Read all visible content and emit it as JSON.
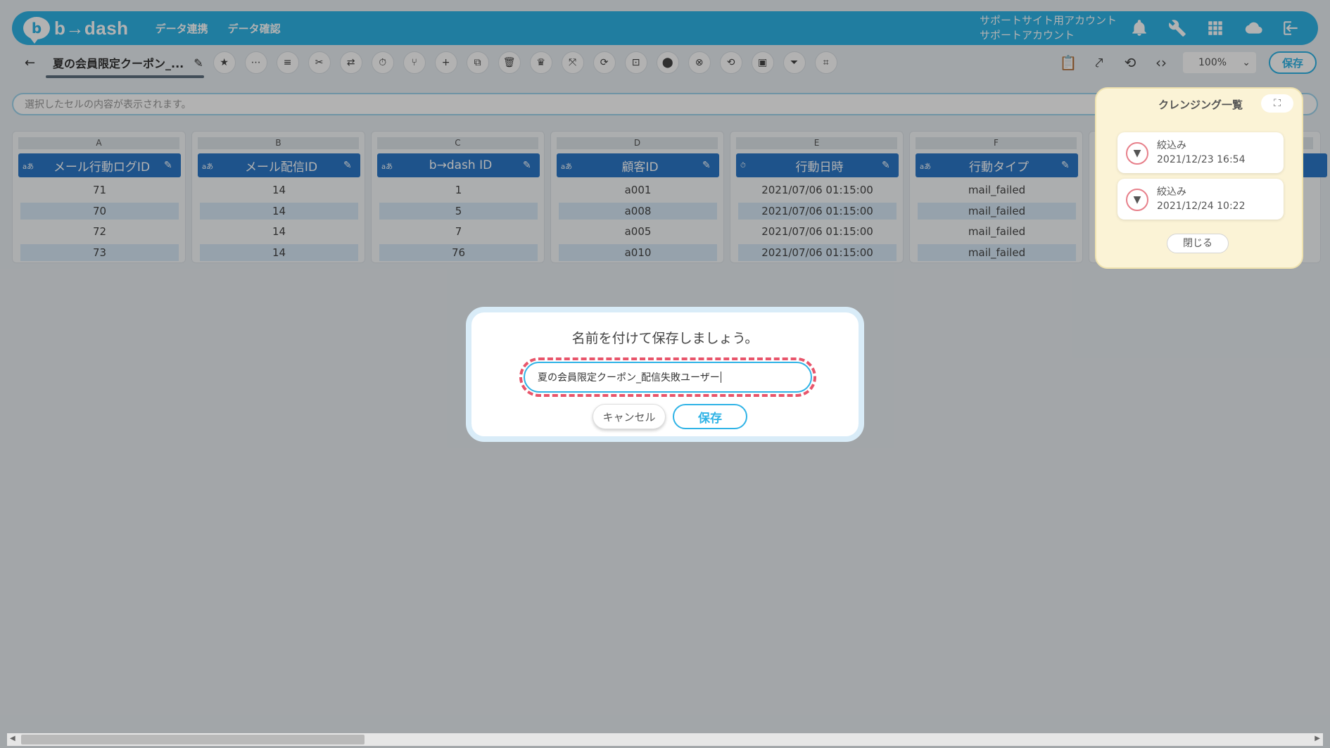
{
  "header": {
    "logo_mark": "b",
    "logo_text": "b→dash",
    "nav": [
      "データ連携",
      "データ確認"
    ],
    "account_line1": "サポートサイト用アカウント",
    "account_line2": "サポートアカウント",
    "icons": [
      "bell-icon",
      "wrench-icon",
      "grid-icon",
      "cloud-icon",
      "logout-icon"
    ]
  },
  "toolbar": {
    "back": "←",
    "title": "夏の会員限定クーポン_...",
    "edit": "✎",
    "tools": [
      "★",
      "⋯",
      "≡",
      "✂",
      "⇄",
      "⏱",
      "⑂",
      "+",
      "⧉",
      "🗑",
      "♛",
      "⤧",
      "⟳",
      "⊡",
      "⬤",
      "⊗",
      "⟲",
      "▣",
      "⏷",
      "⌗"
    ],
    "right_icons": [
      "📋",
      "⤤",
      "⟲",
      "‹›"
    ],
    "zoom": "100%",
    "zoom_caret": "⌄",
    "save": "保存"
  },
  "cellbar": {
    "placeholder": "選択したセルの内容が表示されます。"
  },
  "columns": [
    {
      "letter": "A",
      "type": "aあ",
      "name": "メール行動ログID",
      "edit": "✎",
      "cells": [
        "71",
        "70",
        "72",
        "73"
      ]
    },
    {
      "letter": "B",
      "type": "aあ",
      "name": "メール配信ID",
      "edit": "✎",
      "cells": [
        "14",
        "14",
        "14",
        "14"
      ]
    },
    {
      "letter": "C",
      "type": "aあ",
      "name": "b→dash ID",
      "edit": "✎",
      "cells": [
        "1",
        "5",
        "7",
        "76"
      ]
    },
    {
      "letter": "D",
      "type": "aあ",
      "name": "顧客ID",
      "edit": "✎",
      "cells": [
        "a001",
        "a008",
        "a005",
        "a010"
      ]
    },
    {
      "letter": "E",
      "type": "⏱",
      "name": "行動日時",
      "edit": "✎",
      "cells": [
        "2021/07/06 01:15:00",
        "2021/07/06 01:15:00",
        "2021/07/06 01:15:00",
        "2021/07/06 01:15:00"
      ]
    },
    {
      "letter": "F",
      "type": "aあ",
      "name": "行動タイプ",
      "edit": "✎",
      "cells": [
        "mail_failed",
        "mail_failed",
        "mail_failed",
        "mail_failed"
      ]
    }
  ],
  "cleansing_panel": {
    "title": "クレンジング一覧",
    "expand": "⛶",
    "items": [
      {
        "icon": "filter-icon",
        "label": "絞込み",
        "date": "2021/12/23 16:54"
      },
      {
        "icon": "filter-icon",
        "label": "絞込み",
        "date": "2021/12/24 10:22"
      }
    ],
    "close": "閉じる"
  },
  "dialog": {
    "title": "名前を付けて保存しましょう。",
    "input_value": "夏の会員限定クーポン_配信失敗ユーザー",
    "cancel": "キャンセル",
    "save": "保存"
  },
  "scrollbar": {
    "left": "◀",
    "right": "▶"
  }
}
